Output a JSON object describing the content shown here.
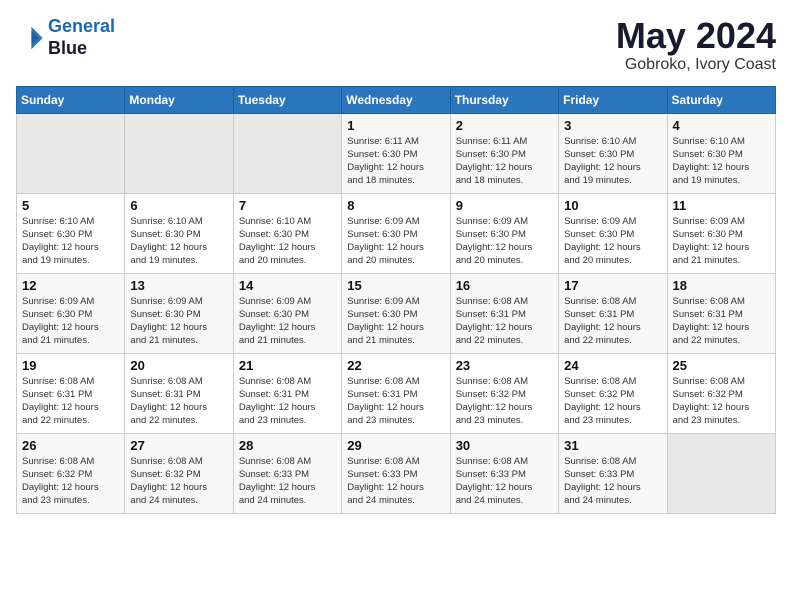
{
  "logo": {
    "line1": "General",
    "line2": "Blue"
  },
  "calendar": {
    "title": "May 2024",
    "subtitle": "Gobroko, Ivory Coast"
  },
  "weekdays": [
    "Sunday",
    "Monday",
    "Tuesday",
    "Wednesday",
    "Thursday",
    "Friday",
    "Saturday"
  ],
  "weeks": [
    [
      {
        "day": "",
        "info": ""
      },
      {
        "day": "",
        "info": ""
      },
      {
        "day": "",
        "info": ""
      },
      {
        "day": "1",
        "info": "Sunrise: 6:11 AM\nSunset: 6:30 PM\nDaylight: 12 hours\nand 18 minutes."
      },
      {
        "day": "2",
        "info": "Sunrise: 6:11 AM\nSunset: 6:30 PM\nDaylight: 12 hours\nand 18 minutes."
      },
      {
        "day": "3",
        "info": "Sunrise: 6:10 AM\nSunset: 6:30 PM\nDaylight: 12 hours\nand 19 minutes."
      },
      {
        "day": "4",
        "info": "Sunrise: 6:10 AM\nSunset: 6:30 PM\nDaylight: 12 hours\nand 19 minutes."
      }
    ],
    [
      {
        "day": "5",
        "info": "Sunrise: 6:10 AM\nSunset: 6:30 PM\nDaylight: 12 hours\nand 19 minutes."
      },
      {
        "day": "6",
        "info": "Sunrise: 6:10 AM\nSunset: 6:30 PM\nDaylight: 12 hours\nand 19 minutes."
      },
      {
        "day": "7",
        "info": "Sunrise: 6:10 AM\nSunset: 6:30 PM\nDaylight: 12 hours\nand 20 minutes."
      },
      {
        "day": "8",
        "info": "Sunrise: 6:09 AM\nSunset: 6:30 PM\nDaylight: 12 hours\nand 20 minutes."
      },
      {
        "day": "9",
        "info": "Sunrise: 6:09 AM\nSunset: 6:30 PM\nDaylight: 12 hours\nand 20 minutes."
      },
      {
        "day": "10",
        "info": "Sunrise: 6:09 AM\nSunset: 6:30 PM\nDaylight: 12 hours\nand 20 minutes."
      },
      {
        "day": "11",
        "info": "Sunrise: 6:09 AM\nSunset: 6:30 PM\nDaylight: 12 hours\nand 21 minutes."
      }
    ],
    [
      {
        "day": "12",
        "info": "Sunrise: 6:09 AM\nSunset: 6:30 PM\nDaylight: 12 hours\nand 21 minutes."
      },
      {
        "day": "13",
        "info": "Sunrise: 6:09 AM\nSunset: 6:30 PM\nDaylight: 12 hours\nand 21 minutes."
      },
      {
        "day": "14",
        "info": "Sunrise: 6:09 AM\nSunset: 6:30 PM\nDaylight: 12 hours\nand 21 minutes."
      },
      {
        "day": "15",
        "info": "Sunrise: 6:09 AM\nSunset: 6:30 PM\nDaylight: 12 hours\nand 21 minutes."
      },
      {
        "day": "16",
        "info": "Sunrise: 6:08 AM\nSunset: 6:31 PM\nDaylight: 12 hours\nand 22 minutes."
      },
      {
        "day": "17",
        "info": "Sunrise: 6:08 AM\nSunset: 6:31 PM\nDaylight: 12 hours\nand 22 minutes."
      },
      {
        "day": "18",
        "info": "Sunrise: 6:08 AM\nSunset: 6:31 PM\nDaylight: 12 hours\nand 22 minutes."
      }
    ],
    [
      {
        "day": "19",
        "info": "Sunrise: 6:08 AM\nSunset: 6:31 PM\nDaylight: 12 hours\nand 22 minutes."
      },
      {
        "day": "20",
        "info": "Sunrise: 6:08 AM\nSunset: 6:31 PM\nDaylight: 12 hours\nand 22 minutes."
      },
      {
        "day": "21",
        "info": "Sunrise: 6:08 AM\nSunset: 6:31 PM\nDaylight: 12 hours\nand 23 minutes."
      },
      {
        "day": "22",
        "info": "Sunrise: 6:08 AM\nSunset: 6:31 PM\nDaylight: 12 hours\nand 23 minutes."
      },
      {
        "day": "23",
        "info": "Sunrise: 6:08 AM\nSunset: 6:32 PM\nDaylight: 12 hours\nand 23 minutes."
      },
      {
        "day": "24",
        "info": "Sunrise: 6:08 AM\nSunset: 6:32 PM\nDaylight: 12 hours\nand 23 minutes."
      },
      {
        "day": "25",
        "info": "Sunrise: 6:08 AM\nSunset: 6:32 PM\nDaylight: 12 hours\nand 23 minutes."
      }
    ],
    [
      {
        "day": "26",
        "info": "Sunrise: 6:08 AM\nSunset: 6:32 PM\nDaylight: 12 hours\nand 23 minutes."
      },
      {
        "day": "27",
        "info": "Sunrise: 6:08 AM\nSunset: 6:32 PM\nDaylight: 12 hours\nand 24 minutes."
      },
      {
        "day": "28",
        "info": "Sunrise: 6:08 AM\nSunset: 6:33 PM\nDaylight: 12 hours\nand 24 minutes."
      },
      {
        "day": "29",
        "info": "Sunrise: 6:08 AM\nSunset: 6:33 PM\nDaylight: 12 hours\nand 24 minutes."
      },
      {
        "day": "30",
        "info": "Sunrise: 6:08 AM\nSunset: 6:33 PM\nDaylight: 12 hours\nand 24 minutes."
      },
      {
        "day": "31",
        "info": "Sunrise: 6:08 AM\nSunset: 6:33 PM\nDaylight: 12 hours\nand 24 minutes."
      },
      {
        "day": "",
        "info": ""
      }
    ]
  ]
}
